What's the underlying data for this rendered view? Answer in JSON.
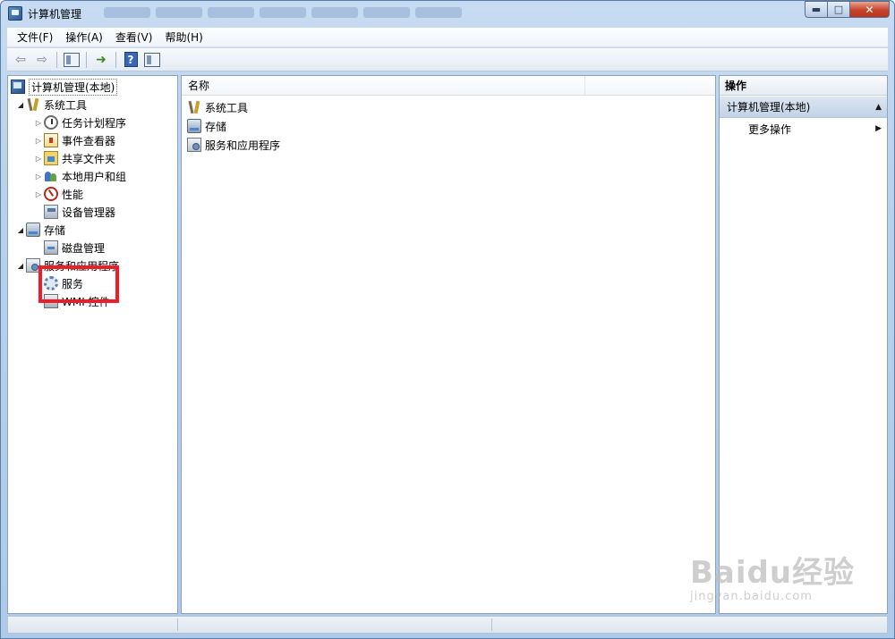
{
  "window": {
    "title": "计算机管理",
    "controls": {
      "minimize": "▬",
      "maximize": "□",
      "close": "✕"
    }
  },
  "menu": [
    "文件(F)",
    "操作(A)",
    "查看(V)",
    "帮助(H)"
  ],
  "toolbar": {
    "back": "⇦",
    "forward": "⇨",
    "help": "?"
  },
  "tree": {
    "root": "计算机管理(本地)",
    "system_tools": "系统工具",
    "task_scheduler": "任务计划程序",
    "event_viewer": "事件查看器",
    "shared_folders": "共享文件夹",
    "local_users": "本地用户和组",
    "performance": "性能",
    "device_manager": "设备管理器",
    "storage": "存储",
    "disk_management": "磁盘管理",
    "services_apps": "服务和应用程序",
    "services": "服务",
    "wmi": "WMI 控件"
  },
  "list": {
    "header_name": "名称",
    "items": [
      "系统工具",
      "存储",
      "服务和应用程序"
    ]
  },
  "actions": {
    "header": "操作",
    "group": "计算机管理(本地)",
    "more": "更多操作"
  },
  "watermark": {
    "main": "Baidu经验",
    "sub": "jingyan.baidu.com"
  },
  "colors": {
    "highlight": "#ef1c2a",
    "titlebar": "#b9d1ea",
    "close_button": "#c7432a"
  }
}
